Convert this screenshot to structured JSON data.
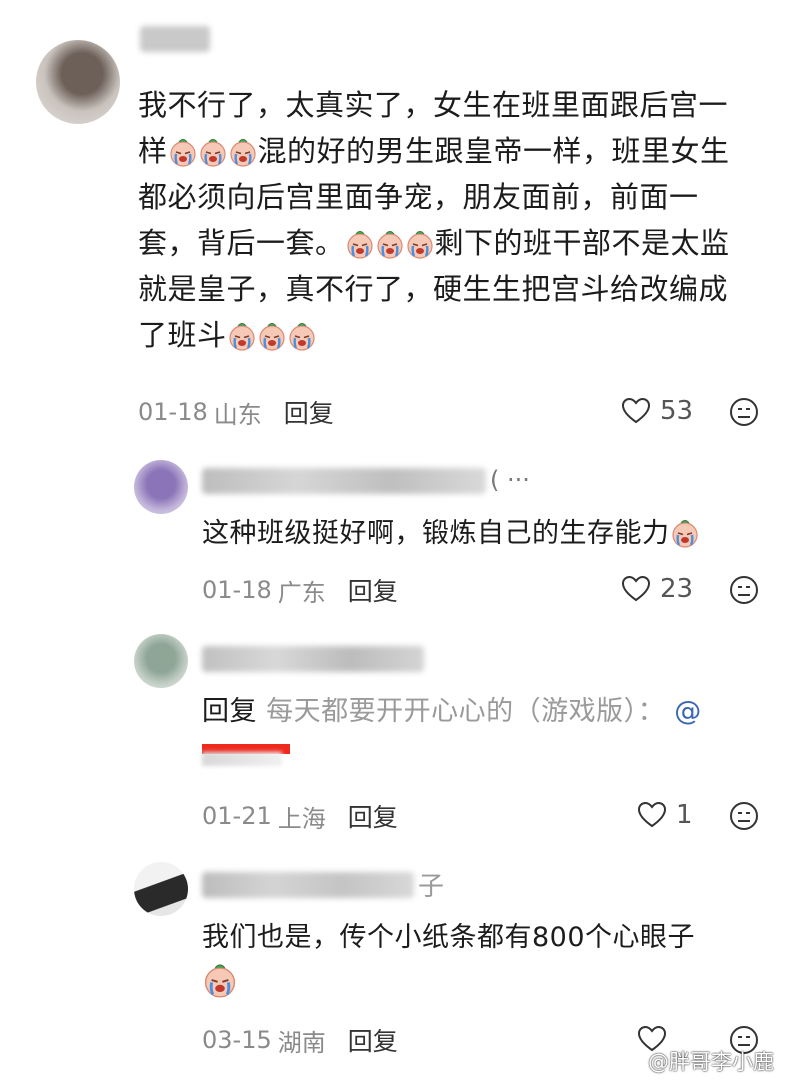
{
  "comments": [
    {
      "text_parts": [
        "我不行了，太真实了，女生在班里面跟后宫一",
        "样",
        "混的好的男生跟皇帝一样，班里女生",
        "都必须向后宫里面争宠，朋友面前，前面一",
        "套，背后一套。",
        "剩下的班干部不是太监",
        "就是皇子，真不行了，硬生生把宫斗给改编成",
        "了班斗"
      ],
      "date": "01-18",
      "location": "山东",
      "reply_label": "回复",
      "likes": "53"
    },
    {
      "ellipsis": "( ···",
      "text": "这种班级挺好啊，锻炼自己的生存能力",
      "date": "01-18",
      "location": "广东",
      "reply_label": "回复",
      "likes": "23"
    },
    {
      "reply_prefix": "回复",
      "quote": "每天都要开开心心的（游戏版）：",
      "at": "@",
      "date": "01-21",
      "location": "上海",
      "reply_label": "回复",
      "likes": "1"
    },
    {
      "name_tail": "子",
      "text": "我们也是，传个小纸条都有800个心眼子",
      "date": "03-15",
      "location": "湖南",
      "reply_label": "回复",
      "likes": ""
    }
  ],
  "watermark": "@胖哥李小鹿",
  "icons": {
    "like": "heart-icon",
    "emoji_reaction": "emoji-reaction-icon",
    "crying_emoji": "crying-face-emoji"
  }
}
